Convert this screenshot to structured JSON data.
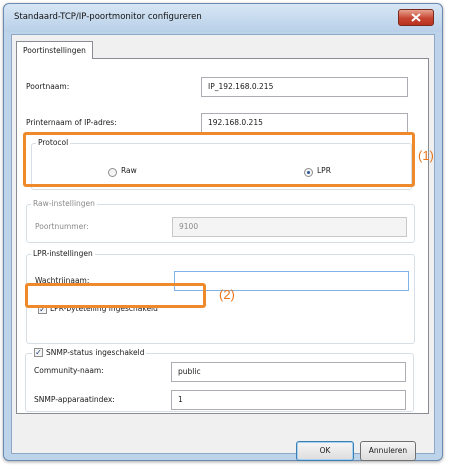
{
  "window": {
    "title": "Standaard-TCP/IP-poortmonitor configureren",
    "close_icon": "close-x-icon"
  },
  "tabs": [
    {
      "label": "Poortinstellingen",
      "selected": true
    }
  ],
  "port_settings": {
    "port_name_label": "Poortnaam:",
    "port_name_value": "IP_192.168.0.215",
    "printer_name_label": "Printernaam of IP-adres:",
    "printer_name_value": "192.168.0.215"
  },
  "protocol": {
    "legend": "Protocol",
    "options": [
      {
        "label": "Raw",
        "selected": false
      },
      {
        "label": "LPR",
        "selected": true
      }
    ]
  },
  "raw_settings": {
    "legend": "Raw-instellingen",
    "port_number_label": "Poortnummer:",
    "port_number_value": "9100"
  },
  "lpr_settings": {
    "legend": "LPR-instellingen",
    "queue_name_label": "Wachtrijnaam:",
    "queue_name_value": "",
    "byte_count_label": "LPR-bytetelling ingeschakeld",
    "byte_count_checked": true
  },
  "snmp": {
    "legend": "SNMP-status ingeschakeld",
    "enabled": true,
    "community_label": "Community-naam:",
    "community_value": "public",
    "device_index_label": "SNMP-apparaatindex:",
    "device_index_value": "1"
  },
  "callouts": {
    "one": "(1)",
    "two": "(2)"
  },
  "highlight_color": "#ef8a2c",
  "buttons": {
    "ok": "OK",
    "cancel": "Annuleren"
  }
}
